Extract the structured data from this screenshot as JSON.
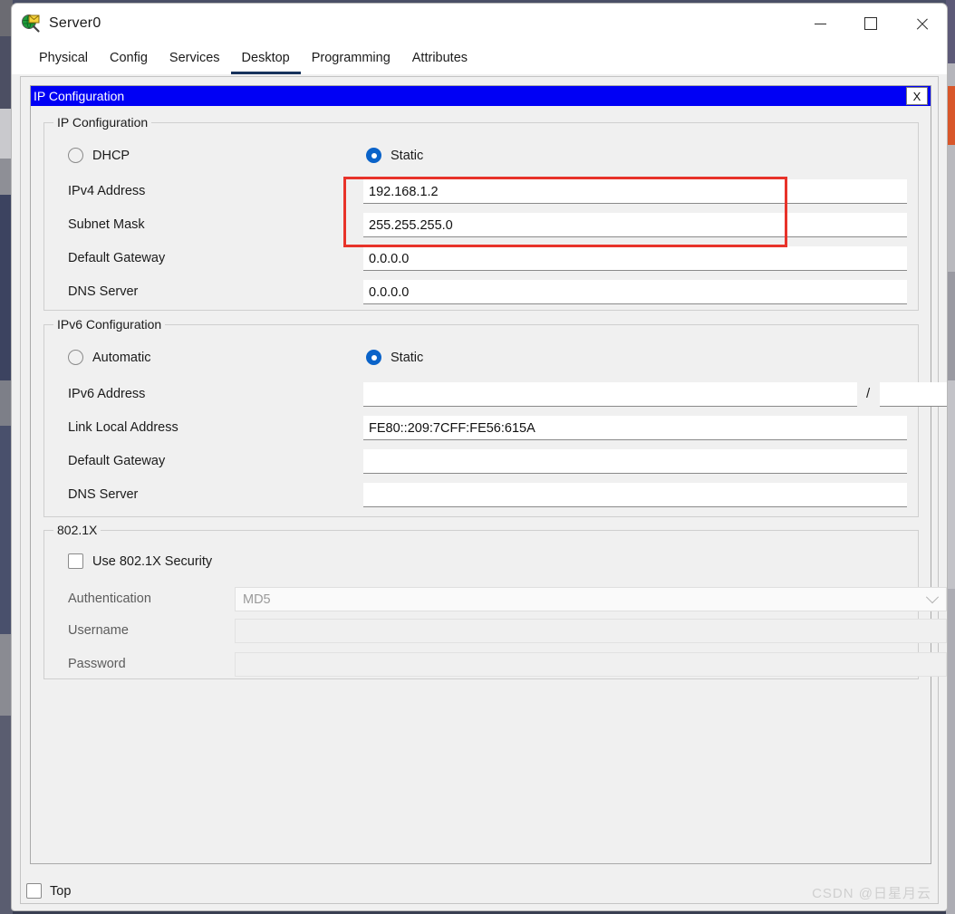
{
  "window": {
    "title": "Server0",
    "icon": "server-device-icon",
    "controls": {
      "minimize": "—",
      "maximize": "□",
      "close": "✕"
    }
  },
  "tabs": [
    {
      "label": "Physical",
      "active": false
    },
    {
      "label": "Config",
      "active": false
    },
    {
      "label": "Services",
      "active": false
    },
    {
      "label": "Desktop",
      "active": true
    },
    {
      "label": "Programming",
      "active": false
    },
    {
      "label": "Attributes",
      "active": false
    }
  ],
  "ip_configuration_window": {
    "caption": "IP Configuration",
    "close_label": "X"
  },
  "ipv4": {
    "group_title": "IP Configuration",
    "mode_dhcp": {
      "label": "DHCP",
      "selected": false
    },
    "mode_static": {
      "label": "Static",
      "selected": true
    },
    "fields": [
      {
        "label": "IPv4 Address",
        "value": "192.168.1.2"
      },
      {
        "label": "Subnet Mask",
        "value": "255.255.255.0"
      },
      {
        "label": "Default Gateway",
        "value": "0.0.0.0"
      },
      {
        "label": "DNS Server",
        "value": "0.0.0.0"
      }
    ]
  },
  "ipv6": {
    "group_title": "IPv6 Configuration",
    "mode_automatic": {
      "label": "Automatic",
      "selected": false
    },
    "mode_static": {
      "label": "Static",
      "selected": true
    },
    "address_label": "IPv6 Address",
    "address_value": "",
    "prefix_separator": "/",
    "prefix_value": "",
    "link_local_label": "Link Local Address",
    "link_local_value": "FE80::209:7CFF:FE56:615A",
    "gateway_label": "Default Gateway",
    "gateway_value": "",
    "dns_label": "DNS Server",
    "dns_value": ""
  },
  "dot1x": {
    "group_title": "802.1X",
    "use_security": {
      "label": "Use 802.1X Security",
      "checked": false
    },
    "authentication_label": "Authentication",
    "authentication_value": "MD5",
    "username_label": "Username",
    "username_value": "",
    "password_label": "Password",
    "password_value": ""
  },
  "bottom": {
    "top_checkbox": {
      "label": "Top",
      "checked": false
    },
    "watermark": "CSDN @日星月云"
  },
  "colors": {
    "caption_blue": "#0000f5",
    "radio_blue": "#0a63c9",
    "annotation_red": "#e8332a",
    "active_tab_underline": "#16325c"
  }
}
